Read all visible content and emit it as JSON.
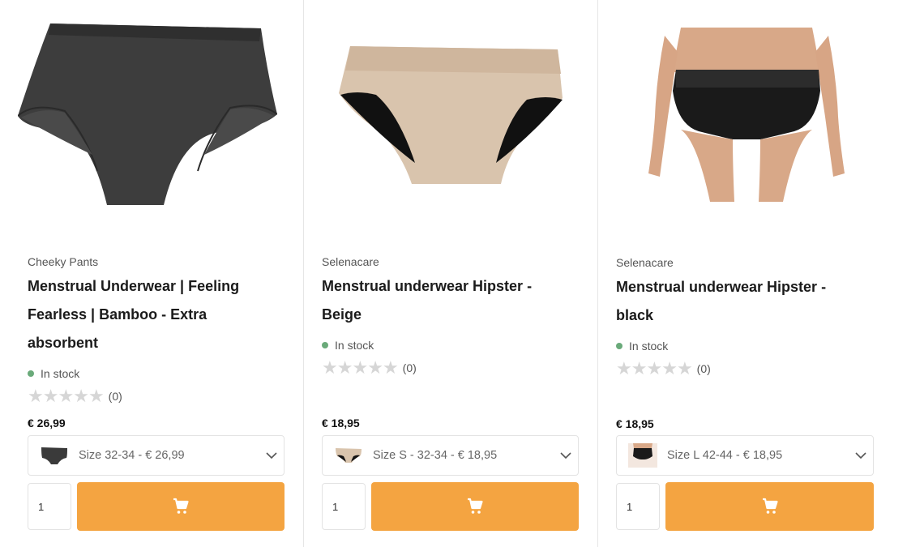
{
  "products": [
    {
      "brand": "Cheeky Pants",
      "title_lines": [
        "Menstrual Underwear | Feeling",
        "Fearless | Bamboo - Extra",
        "absorbent"
      ],
      "stock": "In stock",
      "rating_count": "(0)",
      "rating_value": 0,
      "price": "€ 26,99",
      "variant": "Size 32-34 - € 26,99",
      "qty": "1",
      "image": "dark-grey-high-waist-brief"
    },
    {
      "brand": "Selenacare",
      "title_lines": [
        "Menstrual underwear Hipster -",
        "Beige"
      ],
      "stock": "In stock",
      "rating_count": "(0)",
      "rating_value": 0,
      "price": "€ 18,95",
      "variant": "Size S - 32-34 - € 18,95",
      "qty": "1",
      "image": "beige-hipster-brief"
    },
    {
      "brand": "Selenacare",
      "title_lines": [
        "Menstrual underwear Hipster -",
        "black"
      ],
      "stock": "In stock",
      "rating_count": "(0)",
      "rating_value": 0,
      "price": "€ 18,95",
      "variant": "Size L 42-44 - € 18,95",
      "qty": "1",
      "image": "model-black-hipster"
    }
  ],
  "colors": {
    "accent": "#f4a441",
    "stock_dot": "#6aaa7a",
    "star_empty": "#d6d6d6"
  },
  "icons": {
    "cart": "cart-icon",
    "chevron": "chevron-down-icon",
    "star": "star-icon"
  }
}
